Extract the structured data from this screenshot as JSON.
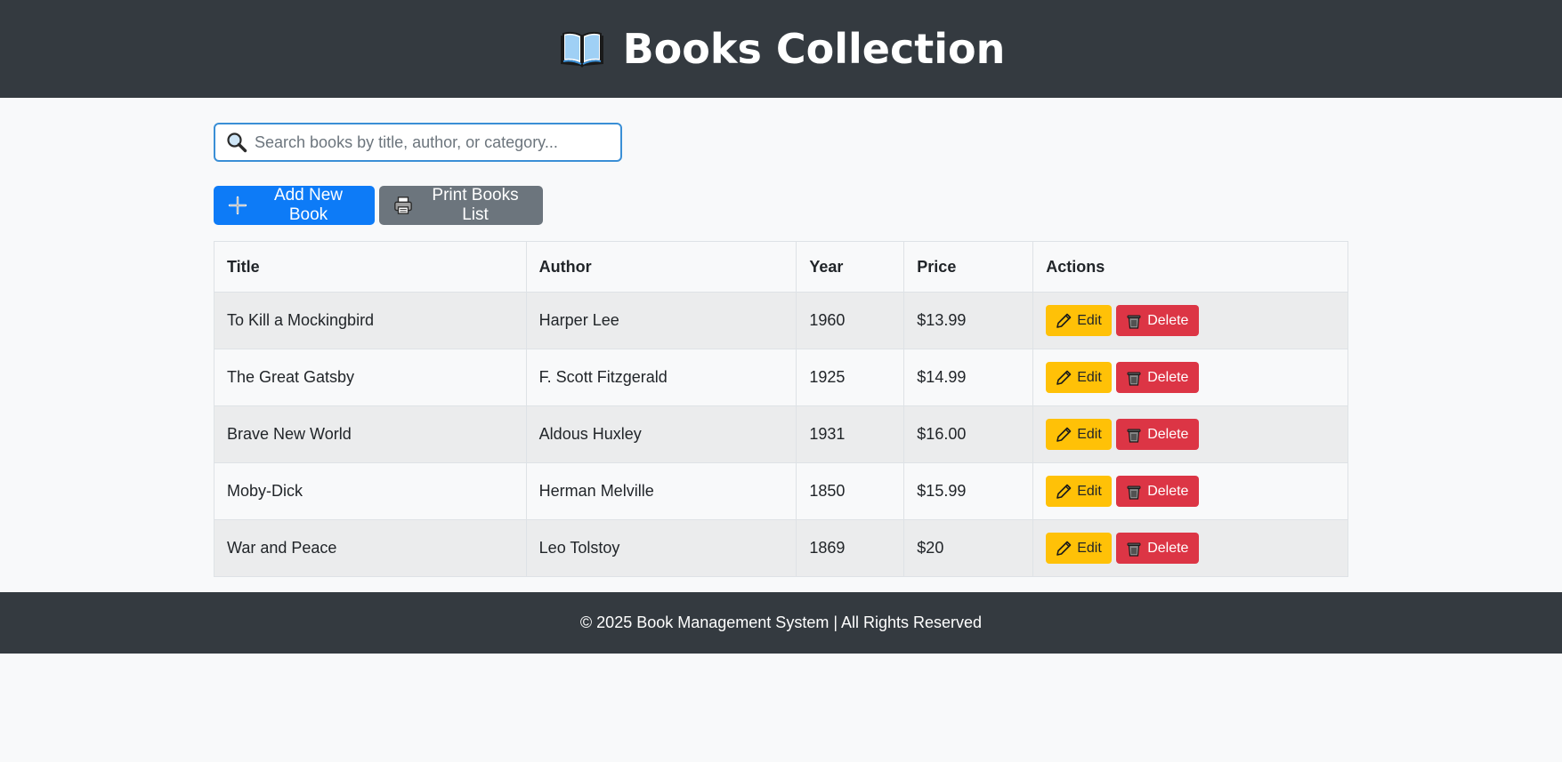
{
  "header": {
    "title": "Books Collection",
    "icon": "open-book-icon"
  },
  "search": {
    "placeholder": "Search books by title, author, or category...",
    "value": "",
    "icon": "search-icon"
  },
  "toolbar": {
    "add_label": "Add New Book",
    "add_icon": "plus-icon",
    "print_label": "Print Books List",
    "print_icon": "printer-icon"
  },
  "table": {
    "columns": [
      "Title",
      "Author",
      "Year",
      "Price",
      "Actions"
    ],
    "rows": [
      {
        "title": "To Kill a Mockingbird",
        "author": "Harper Lee",
        "year": "1960",
        "price": "$13.99"
      },
      {
        "title": "The Great Gatsby",
        "author": "F. Scott Fitzgerald",
        "year": "1925",
        "price": "$14.99"
      },
      {
        "title": "Brave New World",
        "author": "Aldous Huxley",
        "year": "1931",
        "price": "$16.00"
      },
      {
        "title": "Moby-Dick",
        "author": "Herman Melville",
        "year": "1850",
        "price": "$15.99"
      },
      {
        "title": "War and Peace",
        "author": "Leo Tolstoy",
        "year": "1869",
        "price": "$20"
      }
    ],
    "edit_label": "Edit",
    "delete_label": "Delete"
  },
  "footer": {
    "text": "© 2025 Book Management System | All Rights Reserved"
  },
  "colors": {
    "header_bg": "#343a40",
    "primary": "#0d7bf7",
    "secondary": "#6c757d",
    "warning": "#ffc107",
    "danger": "#dc3545",
    "page_bg": "#f8f9fa"
  }
}
